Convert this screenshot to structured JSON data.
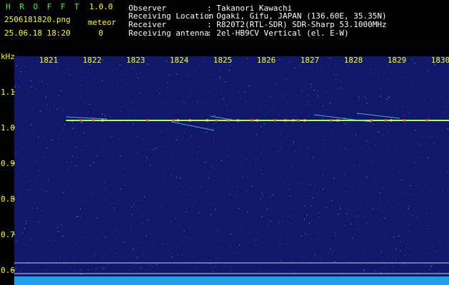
{
  "header": {
    "app_name": "H R O F F T",
    "version": "1.0.0",
    "filename": "2506181820.png",
    "meteor_label": "meteor",
    "timestamp": "25.06.18 18:20",
    "meteor_count": "0",
    "fields": [
      {
        "label": "Observer",
        "value": ": Takanori Kawachi"
      },
      {
        "label": "Receiving Location",
        "value": ": Ogaki, Gifu, JAPAN (136.60E, 35.35N)"
      },
      {
        "label": "Receiver",
        "value": ": R820T2(RTL-SDR) SDR-Sharp 53.1000MHz"
      },
      {
        "label": "Receiving antenna",
        "value": ": 2el-HB9CV Vertical (el. E-W)"
      }
    ]
  },
  "chart_data": {
    "type": "heatmap",
    "ylabel": "kHz",
    "x_ticks": [
      "1821",
      "1822",
      "1823",
      "1824",
      "1825",
      "1826",
      "1827",
      "1828",
      "1829",
      "1830"
    ],
    "y_ticks": [
      "1.1",
      "1.0",
      "0.9",
      "0.8",
      "0.7",
      "0.6"
    ],
    "carrier_khz": 1.02,
    "carrier_start": "1821.4",
    "background_color": "#10186a",
    "label_color": "#ffff00"
  }
}
